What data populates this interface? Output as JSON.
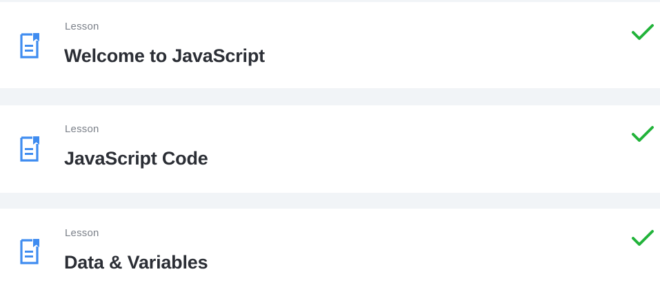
{
  "colors": {
    "icon_blue": "#3f8cf0",
    "check_green": "#22b33a",
    "title_text": "#2b2e35",
    "type_text": "#7b8089",
    "background": "#f1f4f7",
    "card": "#ffffff"
  },
  "lessons": [
    {
      "type": "Lesson",
      "title": "Welcome to JavaScript",
      "icon": "lesson-document-icon",
      "status": "completed",
      "status_icon": "check-icon"
    },
    {
      "type": "Lesson",
      "title": "JavaScript Code",
      "icon": "lesson-document-icon",
      "status": "completed",
      "status_icon": "check-icon"
    },
    {
      "type": "Lesson",
      "title": "Data & Variables",
      "icon": "lesson-document-icon",
      "status": "completed",
      "status_icon": "check-icon"
    }
  ]
}
